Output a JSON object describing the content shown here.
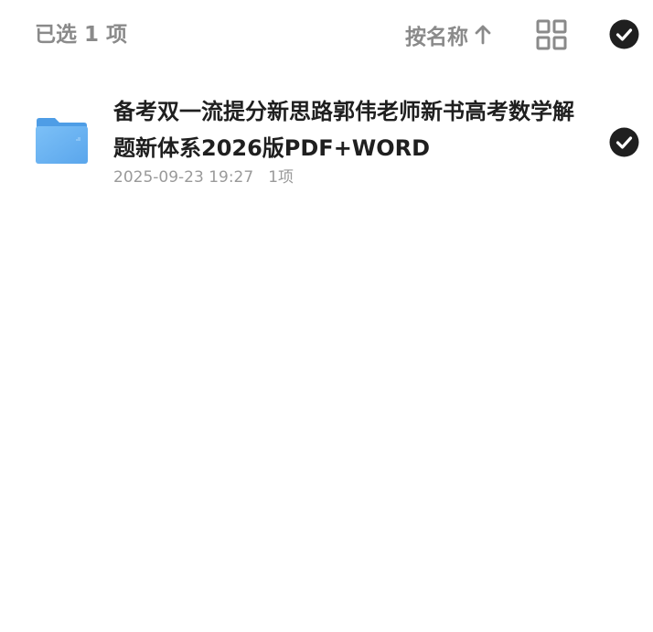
{
  "header": {
    "selected_label": "已选 1 项",
    "sort_label": "按名称",
    "sort_direction_icon": "arrow-up-icon",
    "view_icon": "grid-view-icon",
    "select_all_icon": "check-circle-icon",
    "text_color": "#8a8a8a",
    "check_color": "#1f1f1f"
  },
  "files": [
    {
      "type": "folder",
      "icon": "folder-icon",
      "name": "备考双一流提分新思路郭伟老师新书高考数学解题新体系2026版PDF+WORD",
      "modified": "2025-09-23 19:27",
      "count": "1项",
      "selected": true,
      "folder_color": "#62aef0"
    }
  ]
}
